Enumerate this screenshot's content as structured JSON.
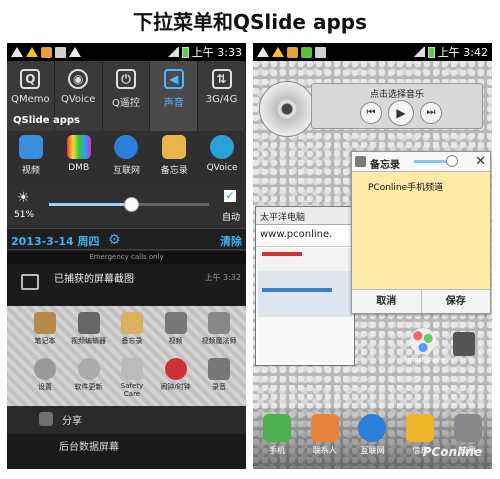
{
  "caption": "下拉菜单和QSlide apps",
  "left": {
    "time": "上午 3:33",
    "quick_settings": [
      {
        "label": "QMemo",
        "icon": "qmemo-icon",
        "glyph": "Q"
      },
      {
        "label": "QVoice",
        "icon": "qvoice-icon",
        "glyph": "◉"
      },
      {
        "label": "Q遥控",
        "icon": "remote-icon",
        "glyph": "⏻"
      },
      {
        "label": "声音",
        "icon": "sound-icon",
        "glyph": "🔊"
      },
      {
        "label": "3G/4G",
        "icon": "data-icon",
        "glyph": "⇅"
      }
    ],
    "qslide_title": "QSlide apps",
    "qslide_apps": [
      {
        "label": "视频",
        "icon": "video-icon",
        "color": "#3a8fe0"
      },
      {
        "label": "DMB",
        "icon": "dmb-icon",
        "color": "#7fb0c8"
      },
      {
        "label": "互联网",
        "icon": "browser-icon",
        "color": "#2a7fd8"
      },
      {
        "label": "备忘录",
        "icon": "memo-icon",
        "color": "#e8b64a"
      },
      {
        "label": "QVoice",
        "icon": "qvoice-app-icon",
        "color": "#2aa0d8"
      }
    ],
    "brightness_pct": "51%",
    "brightness_value": 0.51,
    "auto_label": "自动",
    "date": "2013-3-14 周四",
    "clear": "清除",
    "emergency": "Emergency calls only",
    "notification": {
      "title": "已捕获的屏幕截图",
      "time": "上午 3:32"
    },
    "bg_apps_row1": [
      "笔记本",
      "视频编辑器",
      "备忘录",
      "视频",
      "视频魔法师"
    ],
    "bg_apps_row2": [
      "设置",
      "软件更新",
      "Safety Care",
      "闹钟/时钟",
      "录音"
    ],
    "share": "分享",
    "bottom_text": "后台数据屏幕"
  },
  "right": {
    "time": "上午 3:42",
    "music_title": "点击选择音乐",
    "memo": {
      "title": "备忘录",
      "body": "PConline手机频道",
      "cancel": "取消",
      "save": "保存"
    },
    "browser": {
      "title": "太平洋电脑",
      "url": "www.pconline."
    },
    "smart_share": "SmartShare",
    "dock": [
      {
        "label": "手机",
        "color": "#4caf50"
      },
      {
        "label": "联系人",
        "color": "#e8843a"
      },
      {
        "label": "互联网",
        "color": "#2a7fd8"
      },
      {
        "label": "信息",
        "color": "#f0b429"
      },
      {
        "label": "应用",
        "color": "#888888"
      }
    ],
    "watermark": "PConline"
  }
}
